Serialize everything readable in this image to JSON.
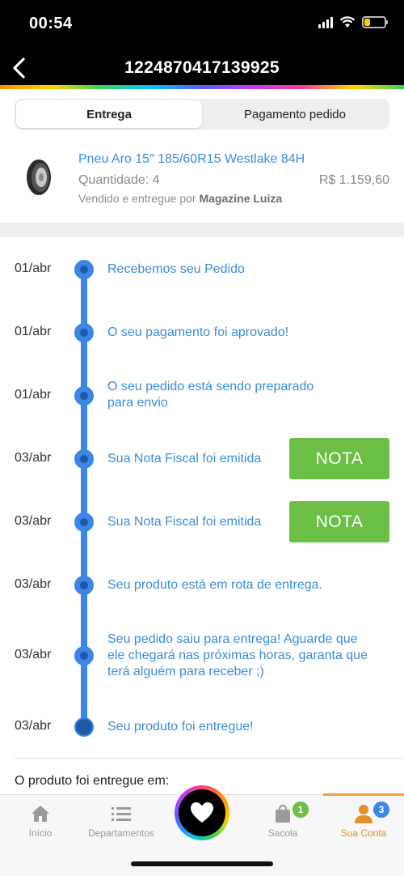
{
  "status_bar": {
    "time": "00:54"
  },
  "header": {
    "title": "1224870417139925",
    "back_icon": "chevron-left-icon"
  },
  "tabs": [
    {
      "label": "Entrega",
      "active": true
    },
    {
      "label": "Pagamento pedido",
      "active": false
    }
  ],
  "product": {
    "name": "Pneu Aro 15″ 185/60R15 Westlake 84H",
    "quantity": "Quantidade: 4",
    "price": "R$ 1.159,60",
    "seller_prefix": "Vendido e entregue por",
    "seller_name": "Magazine Luiza",
    "icon": "tire-icon"
  },
  "timeline": [
    {
      "date": "01/abr",
      "lines": [
        "Recebemos seu Pedido"
      ]
    },
    {
      "date": "01/abr",
      "lines": [
        "O seu pagamento foi aprovado!"
      ]
    },
    {
      "date": "01/abr",
      "lines": [
        "O seu pedido está sendo preparado",
        "para envio"
      ]
    },
    {
      "date": "03/abr",
      "lines": [
        "Sua Nota Fiscal foi emitida"
      ],
      "button": "NOTA"
    },
    {
      "date": "03/abr",
      "lines": [
        "Sua Nota Fiscal foi emitida"
      ],
      "button": "NOTA"
    },
    {
      "date": "03/abr",
      "lines": [
        "Seu produto está em rota de entrega."
      ]
    },
    {
      "date": "03/abr",
      "lines": [
        "Seu pedido saiu para entrega! Aguarde que",
        "ele chegará nas próximas horas, garanta que",
        "terá alguém para receber ;)"
      ]
    },
    {
      "date": "03/abr",
      "lines": [
        "Seu produto foi entregue!"
      ]
    }
  ],
  "delivered_label": "O produto foi entregue em:",
  "bottom_nav": {
    "items": [
      {
        "label": "Início",
        "icon": "home-icon"
      },
      {
        "label": "Departamentos",
        "icon": "list-icon"
      },
      {
        "label": "",
        "icon": "heart-icon"
      },
      {
        "label": "Sacola",
        "icon": "bag-icon",
        "badge": "1"
      },
      {
        "label": "Sua Conta",
        "icon": "user-icon",
        "badge": "3",
        "active": true
      }
    ]
  },
  "colors": {
    "accent_blue": "#3b86e6",
    "link_blue": "#3a8ddb",
    "nota_green": "#6bbf45",
    "active_orange": "#e0902b"
  }
}
